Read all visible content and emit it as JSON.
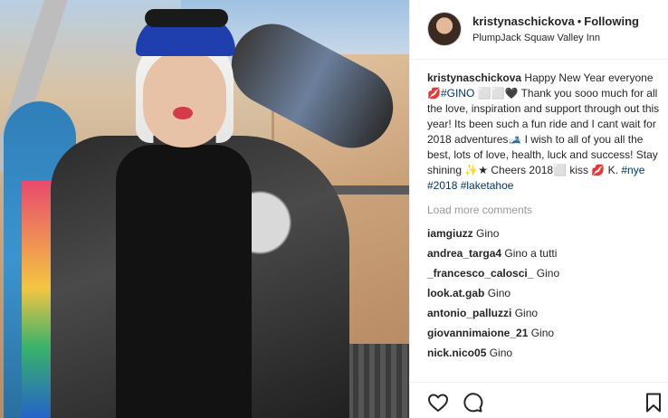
{
  "header": {
    "username": "kristynaschickova",
    "separator": "•",
    "follow_status": "Following",
    "location": "PlumpJack Squaw Valley Inn"
  },
  "caption": {
    "username": "kristynaschickova",
    "text_1": "Happy New Year everyone 💋",
    "hashtag_gino": "#GINO",
    "text_2": " ⬜⬜🖤 Thank you sooo much for all the love, inspiration and support through out this year! Its been such a fun ride and I cant wait for 2018 adventures🎿 I wish to all of you all the best, lots of love, health, luck and success! Stay shining ✨★ Cheers 2018⬜ kiss 💋 K. ",
    "hashtags": [
      "#nye",
      "#2018",
      "#laketahoe"
    ]
  },
  "load_more": "Load more comments",
  "comments": [
    {
      "user": "iamgiuzz",
      "text": "Gino"
    },
    {
      "user": "andrea_targa4",
      "text": "Gino a tutti"
    },
    {
      "user": "_francesco_calosci_",
      "text": "Gino"
    },
    {
      "user": "look.at.gab",
      "text": "Gino"
    },
    {
      "user": "antonio_palluzzi",
      "text": "Gino"
    },
    {
      "user": "giovannimaione_21",
      "text": "Gino"
    },
    {
      "user": "nick.nico05",
      "text": "Gino"
    }
  ],
  "actions": {
    "like_icon": "heart-icon",
    "comment_icon": "comment-bubble-icon",
    "save_icon": "bookmark-icon"
  }
}
